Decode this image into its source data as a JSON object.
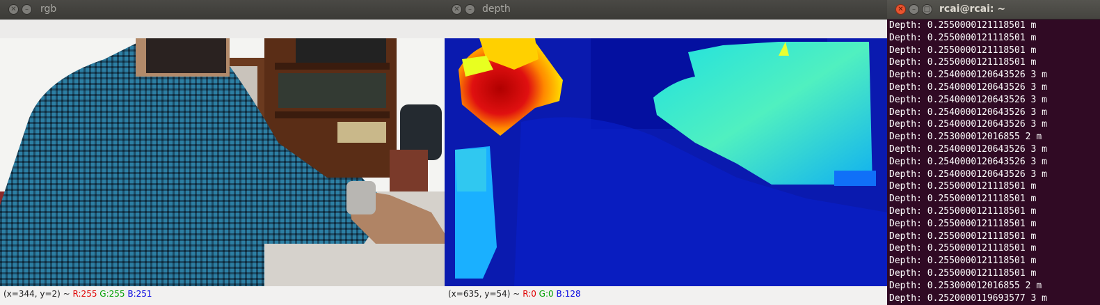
{
  "rgb_window": {
    "title": "rgb",
    "status": {
      "coords": "(x=344, y=2) ~",
      "r": "R:255",
      "g": "G:255",
      "b": "B:251"
    }
  },
  "depth_window": {
    "title": "depth",
    "status": {
      "coords": "(x=635, y=54) ~",
      "r": "R:0",
      "g": "G:0",
      "b": "B:128"
    }
  },
  "terminal": {
    "title": "rcai@rcai: ~",
    "lines": [
      "Depth: 0.2550000121118501 m",
      "Depth: 0.2550000121118501 m",
      "Depth: 0.2550000121118501 m",
      "Depth: 0.2550000121118501 m",
      "Depth: 0.2540000120643526 3 m",
      "Depth: 0.2540000120643526 3 m",
      "Depth: 0.2540000120643526 3 m",
      "Depth: 0.2540000120643526 3 m",
      "Depth: 0.2540000120643526 3 m",
      "Depth: 0.253000012016855 2 m",
      "Depth: 0.2540000120643526 3 m",
      "Depth: 0.2540000120643526 3 m",
      "Depth: 0.2540000120643526 3 m",
      "Depth: 0.2550000121118501 m",
      "Depth: 0.2550000121118501 m",
      "Depth: 0.2550000121118501 m",
      "Depth: 0.2550000121118501 m",
      "Depth: 0.2550000121118501 m",
      "Depth: 0.2550000121118501 m",
      "Depth: 0.2550000121118501 m",
      "Depth: 0.2550000121118501 m",
      "Depth: 0.253000012016855 2 m",
      "Depth: 0.2520000119693577 3 m"
    ]
  }
}
